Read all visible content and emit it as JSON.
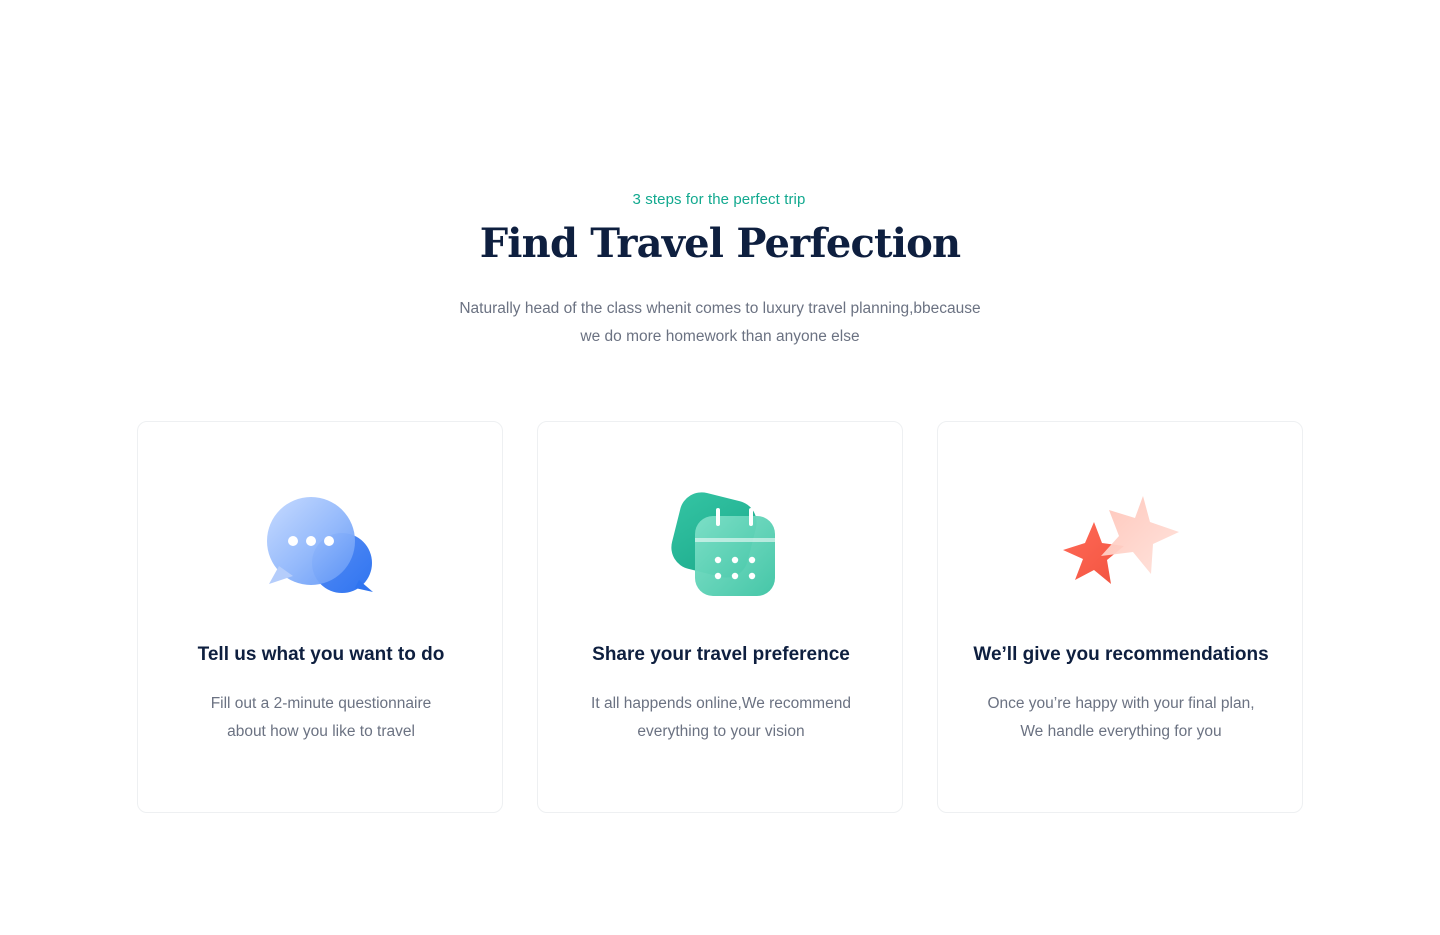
{
  "section": {
    "eyebrow": "3 steps for the perfect trip",
    "title": "Find Travel Perfection",
    "subtitle_lines": [
      "Naturally head of the class whenit comes to luxury travel  planning,bbecause",
      "we do more homework than anyone else"
    ]
  },
  "colors": {
    "accent": "#12a98f",
    "heading": "#0e1f3f",
    "body": "#6b7282",
    "card_border": "#eef0f2"
  },
  "cards": [
    {
      "icon": "chat-bubbles-icon",
      "title": "Tell us what you want to do",
      "desc_lines": [
        "Fill out a 2-minute questionnaire",
        "about how you like to travel"
      ]
    },
    {
      "icon": "calendar-icon",
      "title": "Share your travel preference",
      "desc_lines": [
        "It all happends online,We recommend",
        "everything to your vision"
      ]
    },
    {
      "icon": "stars-icon",
      "title": "We’ll give you recommendations",
      "desc_lines": [
        "Once you’re happy with your final plan,",
        "We handle everything for you"
      ]
    }
  ]
}
